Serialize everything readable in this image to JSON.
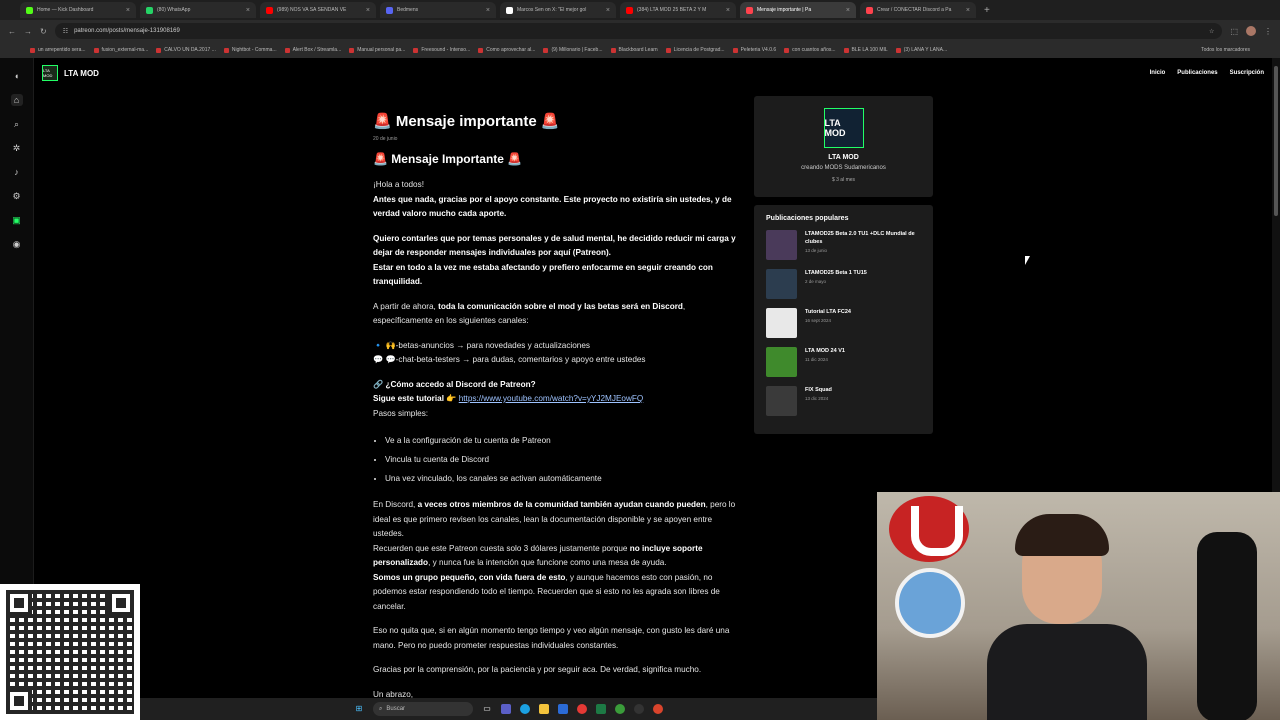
{
  "tabs": [
    {
      "label": "Home — Kick Dashboard",
      "color": "#53fc18"
    },
    {
      "label": "(80) WhatsApp",
      "color": "#25d366"
    },
    {
      "label": "(989) NOS VA SA SENDAN VE",
      "color": "#ff0000"
    },
    {
      "label": "Bedmens",
      "color": "#5865f2"
    },
    {
      "label": "Marcos Sen on X: \"El mejor gol",
      "color": "#ffffff"
    },
    {
      "label": "(384) LTA MOD 25 BETA 2 Y M",
      "color": "#ff0000"
    },
    {
      "label": "Mensaje importante | Pa",
      "color": "#ff424d",
      "active": true
    },
    {
      "label": "Crear / CONECTAR Discord a Pa",
      "color": "#ff424d"
    }
  ],
  "url": "patreon.com/posts/mensaje-131908169",
  "bookmarks": [
    "un arrepentido sera...",
    "fusion_external-ma...",
    "CALVO UN DA.2017 ...",
    "Nightbot - Comma...",
    "Alert Box / Streamla...",
    "Manual personal pa...",
    "Freesound - Intenso...",
    "Como aprovechar al...",
    "(9) Millonario | Faceb...",
    "Blackboard Learn",
    "Licencia de Postgrad...",
    "Peleteria V4.0.6",
    "con cuantos años...",
    "BLE LA 100 MIL",
    "(3) LANA Y LANA..."
  ],
  "bookmarks_other": "Todos los marcadores",
  "site": {
    "name": "LTA MOD",
    "logo_text": "LTA MOD",
    "nav": [
      "Inicio",
      "Publicaciones",
      "Suscripción"
    ]
  },
  "post": {
    "title": "🚨 Mensaje importante 🚨",
    "date": "20 de junio",
    "subtitle": "🚨 Mensaje Importante 🚨",
    "greeting": "¡Hola a todos!",
    "p1": "Antes que nada, gracias por el apoyo constante. Este proyecto no existiría sin ustedes, y de verdad valoro mucho cada aporte.",
    "p2": "Quiero contarles que por temas personales y de salud mental, he decidido reducir mi carga y dejar de responder mensajes individuales por aquí (Patreon).",
    "p3": "Estar en todo a la vez me estaba afectando y prefiero enfocarme en seguir creando con tranquilidad.",
    "p4_pre": "A partir de ahora, ",
    "p4_bold": "toda la comunicación sobre el mod y las betas será en Discord",
    "p4_post": ", específicamente en los siguientes canales:",
    "channel1": "🔹 🙌-betas-anuncios → para novedades y actualizaciones",
    "channel2": "💬 💬-chat-beta-testers → para dudas, comentarios y apoyo entre ustedes",
    "howto": "🔗 ¿Cómo accedo al Discord de Patreon?",
    "tutorial_label": "Sigue este tutorial 👉 ",
    "tutorial_link": "https://www.youtube.com/watch?v=yYJ2MJEowFQ",
    "steps_label": "Pasos simples:",
    "steps": [
      "Ve a la configuración de tu cuenta de Patreon",
      "Vincula tu cuenta de Discord",
      "Una vez vinculado, los canales se activan automáticamente"
    ],
    "p5_pre": "En Discord, ",
    "p5_bold": "a veces otros miembros de la comunidad también ayudan cuando pueden",
    "p5_post": ", pero lo ideal es que primero revisen los canales, lean la documentación disponible y se apoyen entre ustedes.",
    "p6_pre": "Recuerden que este Patreon cuesta solo 3 dólares justamente porque ",
    "p6_bold": "no incluye soporte personalizado",
    "p6_post": ", y nunca fue la intención que funcione como una mesa de ayuda.",
    "p7_bold": "Somos un grupo pequeño, con vida fuera de esto",
    "p7_post": ", y aunque hacemos esto con pasión, no podemos estar respondiendo todo el tiempo. Recuerden que si esto no les agrada son libres de cancelar.",
    "p8": "Eso no quita que, si en algún momento tengo tiempo y veo algún mensaje, con gusto les daré una mano. Pero no puedo prometer respuestas individuales constantes.",
    "p9": "Gracias por la comprensión, por la paciencia y por seguir aca. De verdad, significa mucho.",
    "signoff": "Un abrazo,"
  },
  "creator_card": {
    "logo_text": "LTA MOD",
    "name": "LTA MOD",
    "description": "creando MODS Sudamericanos",
    "price": "$ 3 al mes"
  },
  "popular": {
    "title": "Publicaciones populares",
    "items": [
      {
        "title": "LTAMOD25 Beta 2.0 TU1 +DLC Mundial de clubes",
        "date": "13 de junio",
        "thumb": "#4a3a5a"
      },
      {
        "title": "LTAMOD25 Beta 1 TU15",
        "date": "2 de mayo",
        "thumb": "#2c3d4f"
      },
      {
        "title": "Tutorial LTA FC24",
        "date": "16 sept 2024",
        "thumb": "#e8e8e8"
      },
      {
        "title": "LTA MOD 24 V1",
        "date": "11 dic 2024",
        "thumb": "#3f8a2c"
      },
      {
        "title": "FIX Squad",
        "date": "13 dic 2024",
        "thumb": "#3a3a3a"
      }
    ]
  },
  "taskbar": {
    "search_placeholder": "Buscar"
  }
}
